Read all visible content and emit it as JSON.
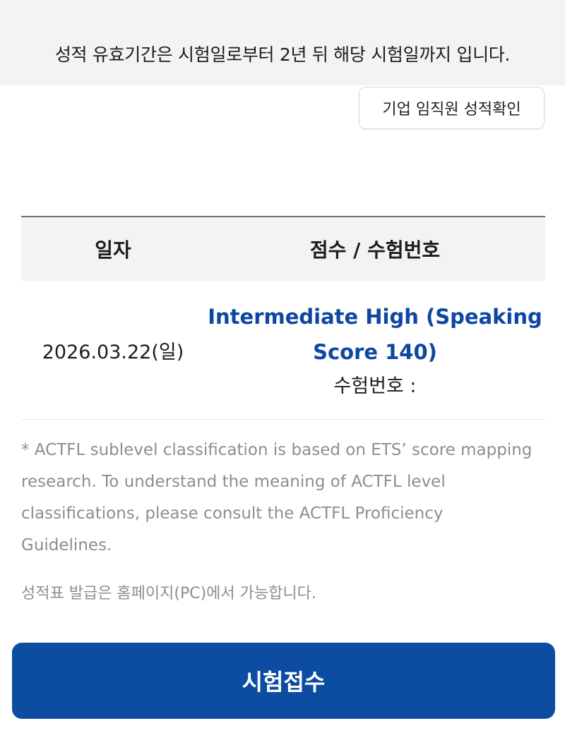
{
  "notice": {
    "text": "성적 유효기간은 시험일로부터 2년 뒤 해당 시험일까지 입니다."
  },
  "corporate_check_button": {
    "label": "기업 임직원 성적확인"
  },
  "score_table": {
    "headers": {
      "date": "일자",
      "score": "점수 / 수험번호"
    },
    "rows": [
      {
        "date": "2026.03.22(일)",
        "level_line1": "Intermediate High (Speaking",
        "level_line2": "Score 140)",
        "exam_number_label": "수험번호 :",
        "exam_number_value": ""
      }
    ]
  },
  "footnote": {
    "text": "* ACTFL sublevel classification is based on ETS’ score mapping research. To understand the meaning of ACTFL level classifications, please consult the ACTFL Proficiency Guidelines."
  },
  "pc_note": {
    "text": "성적표 발급은 홈페이지(PC)에서 가능합니다."
  },
  "apply_button": {
    "label": "시험접수"
  },
  "colors": {
    "accent": "#0d4da1",
    "score_text": "#0d47a1",
    "header_bg": "#f2f3f5",
    "muted_text": "#8a8e94"
  }
}
